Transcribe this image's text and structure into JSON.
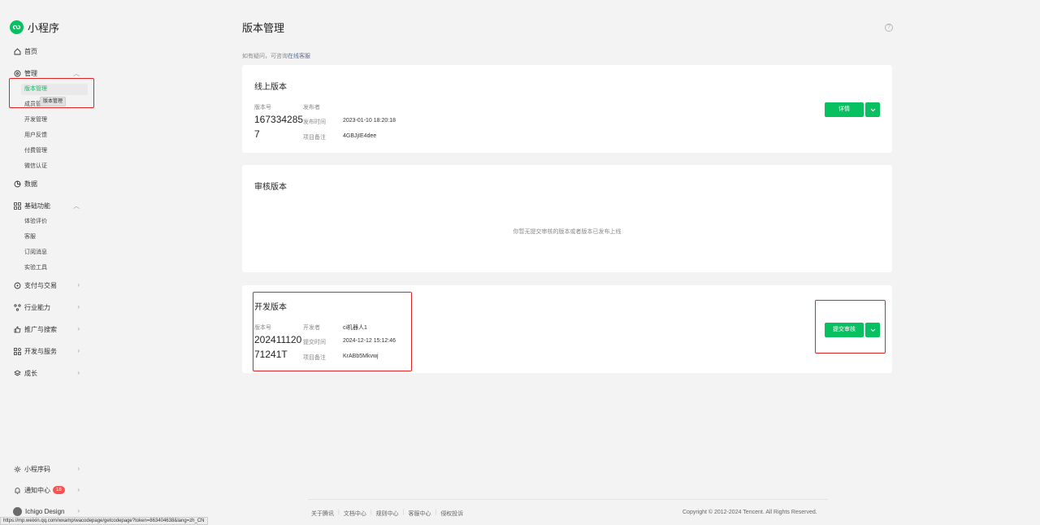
{
  "app": {
    "name": "小程序"
  },
  "sidebar": {
    "home": "首页",
    "manage": "管理",
    "manage_items": [
      "版本管理",
      "成员管理",
      "开发管理",
      "用户反馈",
      "付费管理",
      "微信认证"
    ],
    "tooltip": "版本管理",
    "data": "数据",
    "basic": "基础功能",
    "basic_items": [
      "体验评价",
      "客服",
      "订阅消息",
      "实验工具"
    ],
    "pay": "支付与交易",
    "industry": "行业能力",
    "promo": "推广与搜索",
    "devservice": "开发与服务",
    "growth": "成长",
    "qrcode": "小程序码",
    "notify": "通知中心",
    "notify_count": "18",
    "user": "Ichigo Design"
  },
  "page": {
    "title": "版本管理",
    "notice_prefix": "如有疑问，可咨询",
    "notice_link": "在线客服"
  },
  "online": {
    "title": "线上版本",
    "version_label": "版本号",
    "version": "1673342857",
    "publisher_label": "发布者",
    "time_label": "发布时间",
    "time": "2023-01-10 18:20:18",
    "note_label": "项目备注",
    "note": "4GBJjIE4dee",
    "detail_button": "详情"
  },
  "review": {
    "title": "审核版本",
    "empty": "你暂无提交审核的版本或者版本已发布上线"
  },
  "dev": {
    "title": "开发版本",
    "version_label": "版本号",
    "version": "20241112071241T",
    "developer_label": "开发者",
    "developer": "ci机器人1",
    "time_label": "提交时间",
    "time": "2024-12-12 15:12:46",
    "note_label": "项目备注",
    "note": "KrABb5Mkvwj",
    "submit_button": "提交审核"
  },
  "footer": {
    "links": [
      "关于腾讯",
      "文档中心",
      "规则中心",
      "客服中心",
      "侵权投诉"
    ],
    "copyright": "Copyright © 2012-2024 Tencent. All Rights Reserved."
  },
  "status_url": "https://mp.weixin.qq.com/wxamp/wacodepage/getcodepage?token=863404638&lang=zh_CN",
  "colors": {
    "accent": "#07c160",
    "annotation": "#e32222",
    "link": "#576b95"
  }
}
